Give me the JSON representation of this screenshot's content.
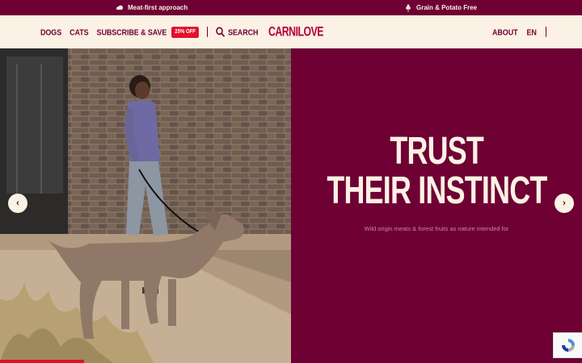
{
  "promo_bar": {
    "left": {
      "text": "Meat-first approach",
      "icon": "bone-icon"
    },
    "right": {
      "text": "Grain & Potato Free",
      "icon": "wheat-icon"
    }
  },
  "header": {
    "nav_left": [
      {
        "label": "DOGS"
      },
      {
        "label": "CATS"
      },
      {
        "label": "SUBSCRIBE & SAVE",
        "badge": "25% OFF"
      }
    ],
    "search_label": "SEARCH",
    "logo": "CARNILOVE",
    "nav_right": [
      {
        "label": "ABOUT"
      },
      {
        "label": "EN"
      }
    ]
  },
  "hero": {
    "headline_line1": "TRUST",
    "headline_line2": "THEIR INSTINCT",
    "subtitle": "Wild origin meats & forest fruits as nature intended for",
    "prev_arrow": "‹",
    "next_arrow": "›",
    "image_alt": "Woman walking a Weimaraner dog in front of a brick wall"
  },
  "colors": {
    "brand_maroon": "#6e0034",
    "logo_red": "#b4003c",
    "cream": "#fbf1e4",
    "badge_red": "#e0112c"
  }
}
